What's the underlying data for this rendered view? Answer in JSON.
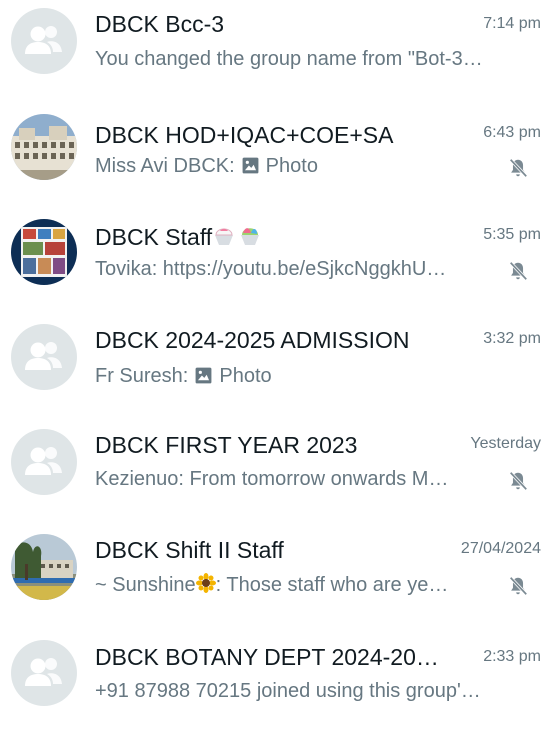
{
  "chats": [
    {
      "name": "DBCK Bcc-3",
      "time": "7:14 pm",
      "preview": "You changed the group name from \"Bot-3…",
      "avatar": "group-default-icon",
      "muted": false
    },
    {
      "name": "DBCK HOD+IQAC+COE+SA",
      "time": "6:43 pm",
      "sender": "Miss Avi DBCK:",
      "attachment": "Photo",
      "avatar": "building-photo",
      "muted": true
    },
    {
      "name": "DBCK Staff",
      "time": "5:35 pm",
      "preview": "Tovika: https://youtu.be/eSjkcNggkhU…",
      "avatar": "collage-photo",
      "muted": true
    },
    {
      "name": "DBCK 2024-2025 ADMISSION",
      "time": "3:32 pm",
      "sender": "Fr Suresh:",
      "attachment": "Photo",
      "avatar": "group-default-icon",
      "muted": false
    },
    {
      "name": "DBCK FIRST YEAR 2023",
      "time": "Yesterday",
      "preview": "Kezienuo: From tomorrow onwards M…",
      "avatar": "group-default-icon",
      "muted": true
    },
    {
      "name": "DBCK Shift II Staff",
      "time": "27/04/2024",
      "sender_prefix": "~ Sunshine",
      "preview": ": Those staff who are ye…",
      "avatar": "campus-photo",
      "muted": true
    },
    {
      "name": "DBCK BOTANY DEPT 2024-20…",
      "time": "2:33 pm",
      "preview": "+91 87988 70215 joined using this group'…",
      "avatar": "group-default-icon",
      "muted": false
    }
  ],
  "colors": {
    "name_text": "#111b21",
    "secondary_text": "#667781",
    "default_avatar_bg": "#dfe5e7",
    "default_avatar_fg": "#ffffff"
  }
}
